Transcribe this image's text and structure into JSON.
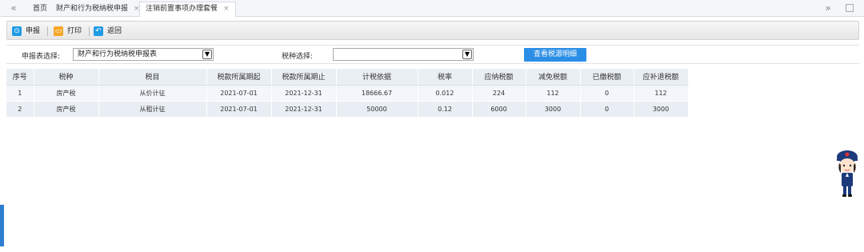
{
  "tabbar": {
    "nav_back_icon": "double-chevron-left-icon",
    "nav_forward_icon": "double-chevron-right-icon",
    "tabs": [
      {
        "label": "首页",
        "closable": false,
        "active": false
      },
      {
        "label": "财产和行为税纳税申报",
        "closable": true,
        "active": false
      },
      {
        "label": "注销前置事项办理套餐",
        "closable": true,
        "active": true
      }
    ]
  },
  "toolbar": {
    "declare_label": "申报",
    "print_label": "打印",
    "back_label": "返回"
  },
  "filter": {
    "form_label": "申报表选择:",
    "form_value": "财产和行为税纳税申报表",
    "tax_label": "税种选择:",
    "tax_value": "",
    "query_button": "查看税源明细"
  },
  "table": {
    "headers": [
      "序号",
      "税种",
      "税目",
      "税款所属期起",
      "税款所属期止",
      "计税依据",
      "税率",
      "应纳税额",
      "减免税额",
      "已缴税额",
      "应补退税额"
    ],
    "rows": [
      [
        "1",
        "房产税",
        "从价计征",
        "2021-07-01",
        "2021-12-31",
        "18666.67",
        "0.012",
        "224",
        "112",
        "0",
        "112"
      ],
      [
        "2",
        "房产税",
        "从租计征",
        "2021-07-01",
        "2021-12-31",
        "50000",
        "0.12",
        "6000",
        "3000",
        "0",
        "3000"
      ]
    ]
  },
  "colors": {
    "accent": "#2b8ee6",
    "declare_icon": "#1e9be6",
    "print_icon": "#f5a623",
    "back_icon": "#1e9be6"
  }
}
